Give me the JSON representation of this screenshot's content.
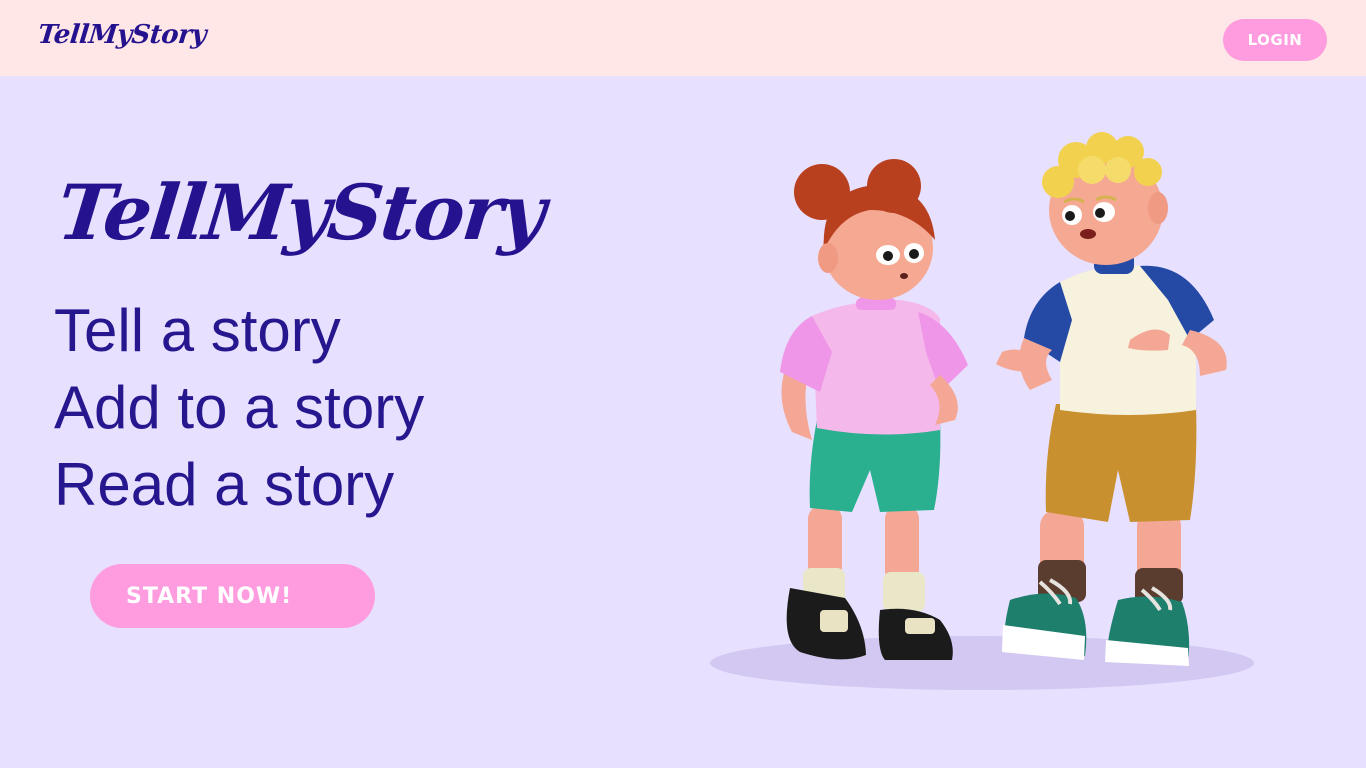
{
  "header": {
    "logo_text": "TellMyStory",
    "login_label": "LOGIN"
  },
  "hero": {
    "title": "TellMyStory",
    "taglines": [
      "Tell a story",
      "Add to a story",
      "Read a story"
    ],
    "cta_label": "START NOW!"
  },
  "colors": {
    "brand": "#24128e",
    "accent": "#ff9cdf",
    "header_bg": "#ffe7e8",
    "page_bg": "#e8e0ff"
  }
}
